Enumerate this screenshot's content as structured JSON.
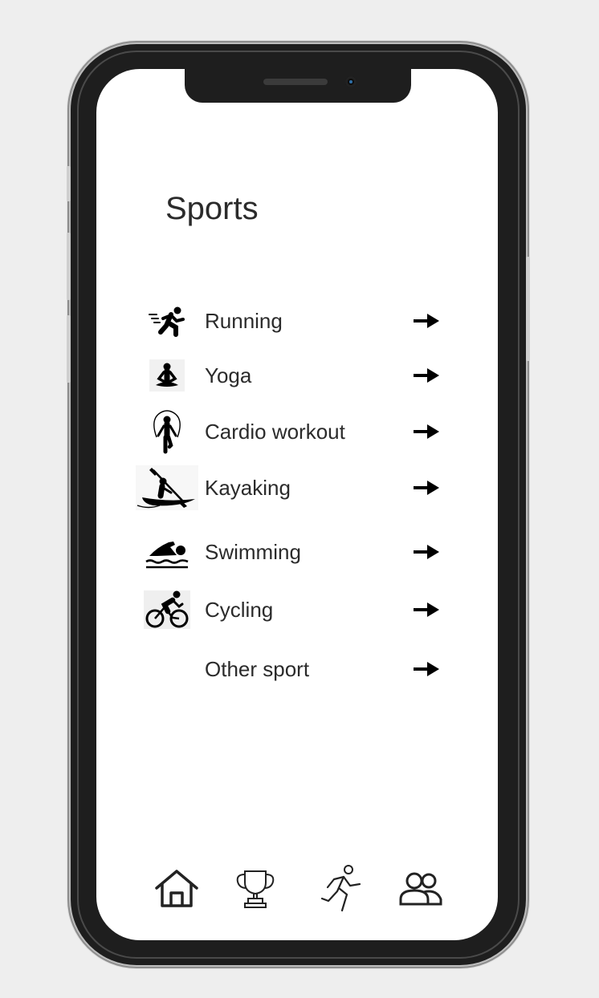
{
  "header": {
    "title": "Sports"
  },
  "sports": [
    {
      "label": "Running",
      "icon": "running-icon"
    },
    {
      "label": "Yoga",
      "icon": "yoga-icon"
    },
    {
      "label": "Cardio workout",
      "icon": "jump-rope-icon"
    },
    {
      "label": "Kayaking",
      "icon": "kayaking-icon"
    },
    {
      "label": "Swimming",
      "icon": "swimming-icon"
    },
    {
      "label": "Cycling",
      "icon": "cycling-icon"
    },
    {
      "label": "Other sport",
      "icon": ""
    }
  ],
  "tabbar": {
    "items": [
      {
        "icon": "home-icon"
      },
      {
        "icon": "trophy-icon"
      },
      {
        "icon": "runner-icon"
      },
      {
        "icon": "users-icon"
      }
    ]
  },
  "colors": {
    "text": "#2b2b2b",
    "icon": "#000000",
    "screen": "#ffffff",
    "frame": "#1e1e1e"
  }
}
